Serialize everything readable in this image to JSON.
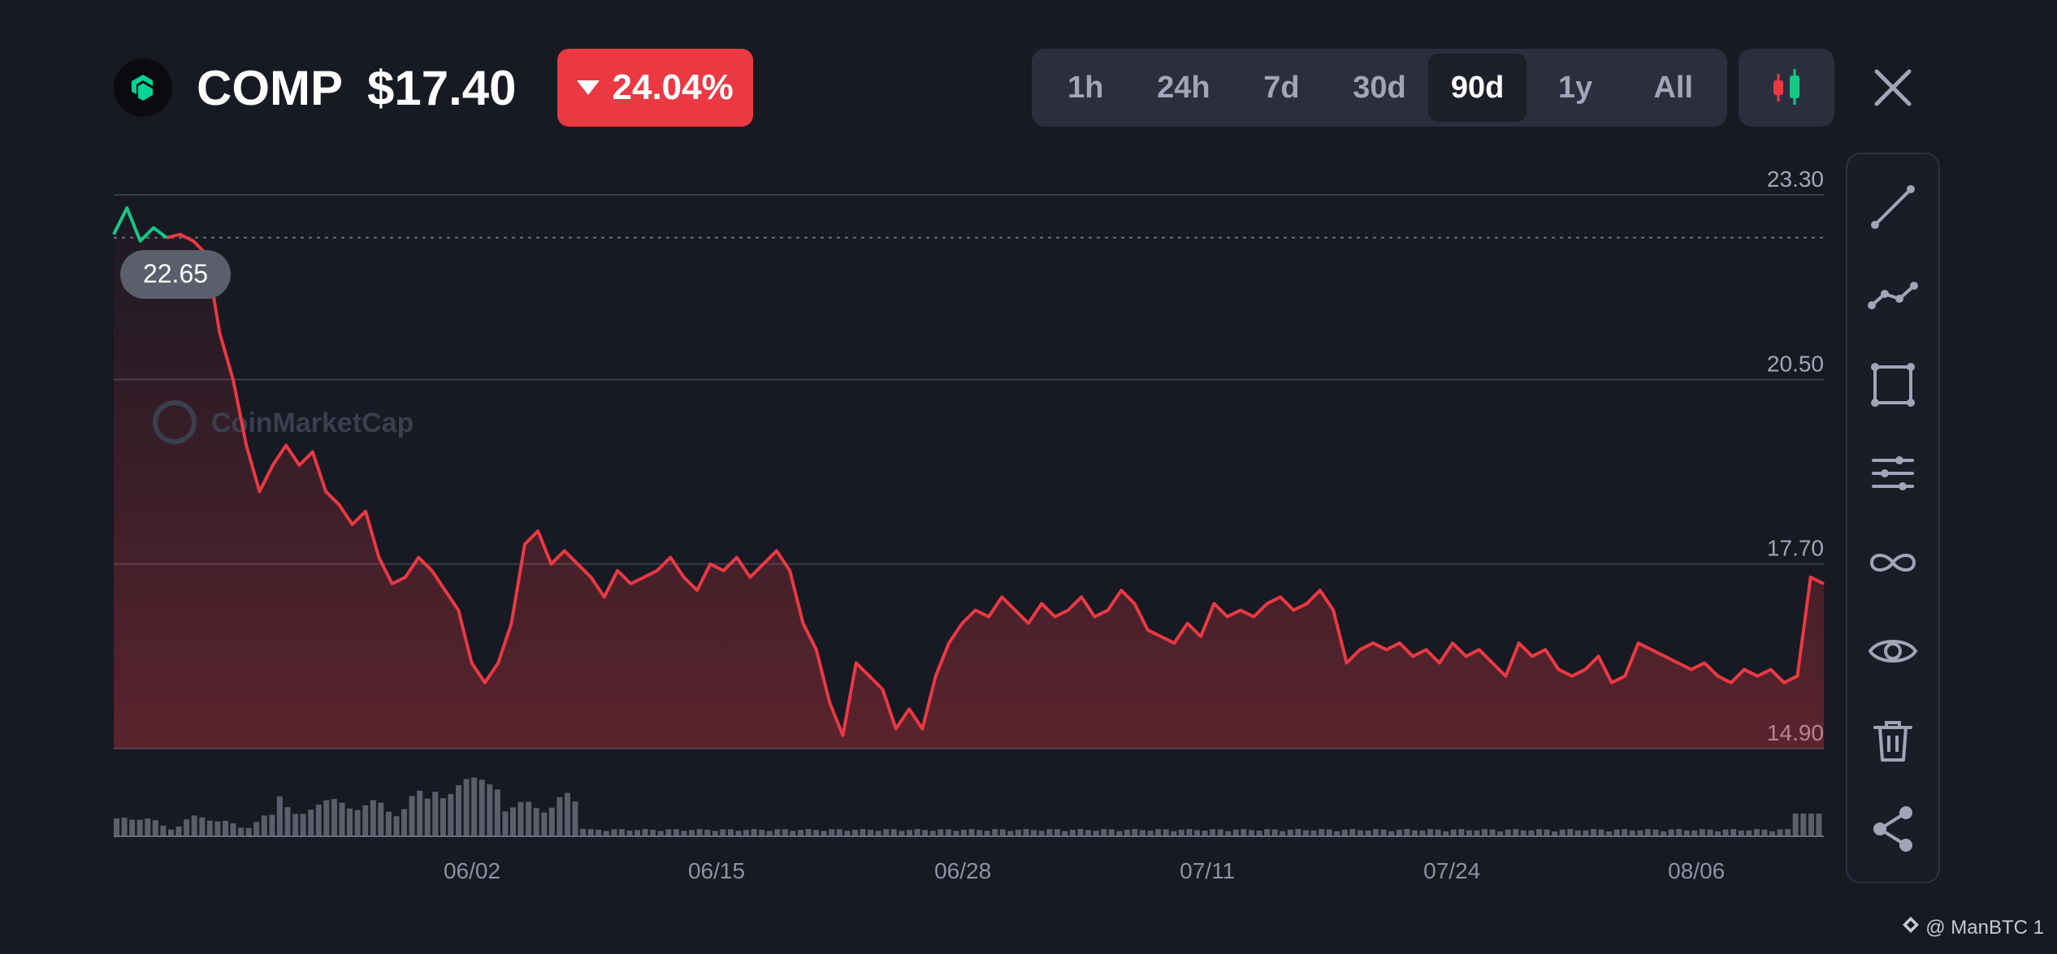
{
  "header": {
    "symbol": "COMP",
    "price": "$17.40",
    "change": "24.04%",
    "change_color": "#ea3943"
  },
  "ranges": [
    {
      "label": "1h",
      "active": false
    },
    {
      "label": "24h",
      "active": false
    },
    {
      "label": "7d",
      "active": false
    },
    {
      "label": "30d",
      "active": false
    },
    {
      "label": "90d",
      "active": true
    },
    {
      "label": "1y",
      "active": false
    },
    {
      "label": "All",
      "active": false
    }
  ],
  "icons": {
    "candle": "candlestick-icon",
    "close": "close-icon",
    "tools": [
      "trend-line-icon",
      "polyline-icon",
      "rectangle-icon",
      "parallel-lines-icon",
      "infinity-icon",
      "eye-icon",
      "trash-icon",
      "share-icon"
    ]
  },
  "watermark": "CoinMarketCap",
  "credit": "@ ManBTC 1",
  "chart_data": {
    "type": "line",
    "y_ticks": [
      "23.30",
      "20.50",
      "17.70",
      "14.90"
    ],
    "ylim": [
      14.9,
      23.3
    ],
    "x_ticks": [
      "06/02",
      "06/15",
      "06/28",
      "07/11",
      "07/24",
      "08/06"
    ],
    "x_positions": [
      0.143,
      0.286,
      0.43,
      0.573,
      0.716,
      0.859
    ],
    "open_label": "22.65",
    "open_value": 22.65,
    "line_color": "#ea3943",
    "start_color": "#16c784",
    "series": [
      {
        "values": [
          22.7,
          23.1,
          22.6,
          22.8,
          22.65,
          22.7,
          22.6,
          22.4,
          21.2,
          20.5,
          19.5,
          18.8,
          19.2,
          19.5,
          19.2,
          19.4,
          18.8,
          18.6,
          18.3,
          18.5,
          17.8,
          17.4,
          17.5,
          17.8,
          17.6,
          17.3,
          17.0,
          16.2,
          15.9,
          16.2,
          16.8,
          18.0,
          18.2,
          17.7,
          17.9,
          17.7,
          17.5,
          17.2,
          17.6,
          17.4,
          17.5,
          17.6,
          17.8,
          17.5,
          17.3,
          17.7,
          17.6,
          17.8,
          17.5,
          17.7,
          17.9,
          17.6,
          16.8,
          16.4,
          15.6,
          15.1,
          16.2,
          16.0,
          15.8,
          15.2,
          15.5,
          15.2,
          16.0,
          16.5,
          16.8,
          17.0,
          16.9,
          17.2,
          17.0,
          16.8,
          17.1,
          16.9,
          17.0,
          17.2,
          16.9,
          17.0,
          17.3,
          17.1,
          16.7,
          16.6,
          16.5,
          16.8,
          16.6,
          17.1,
          16.9,
          17.0,
          16.9,
          17.1,
          17.2,
          17.0,
          17.1,
          17.3,
          17.0,
          16.2,
          16.4,
          16.5,
          16.4,
          16.5,
          16.3,
          16.4,
          16.2,
          16.5,
          16.3,
          16.4,
          16.2,
          16.0,
          16.5,
          16.3,
          16.4,
          16.1,
          16.0,
          16.1,
          16.3,
          15.9,
          16.0,
          16.5,
          16.4,
          16.3,
          16.2,
          16.1,
          16.2,
          16.0,
          15.9,
          16.1,
          16.0,
          16.1,
          15.9,
          16.0,
          17.5,
          17.4
        ]
      }
    ]
  }
}
